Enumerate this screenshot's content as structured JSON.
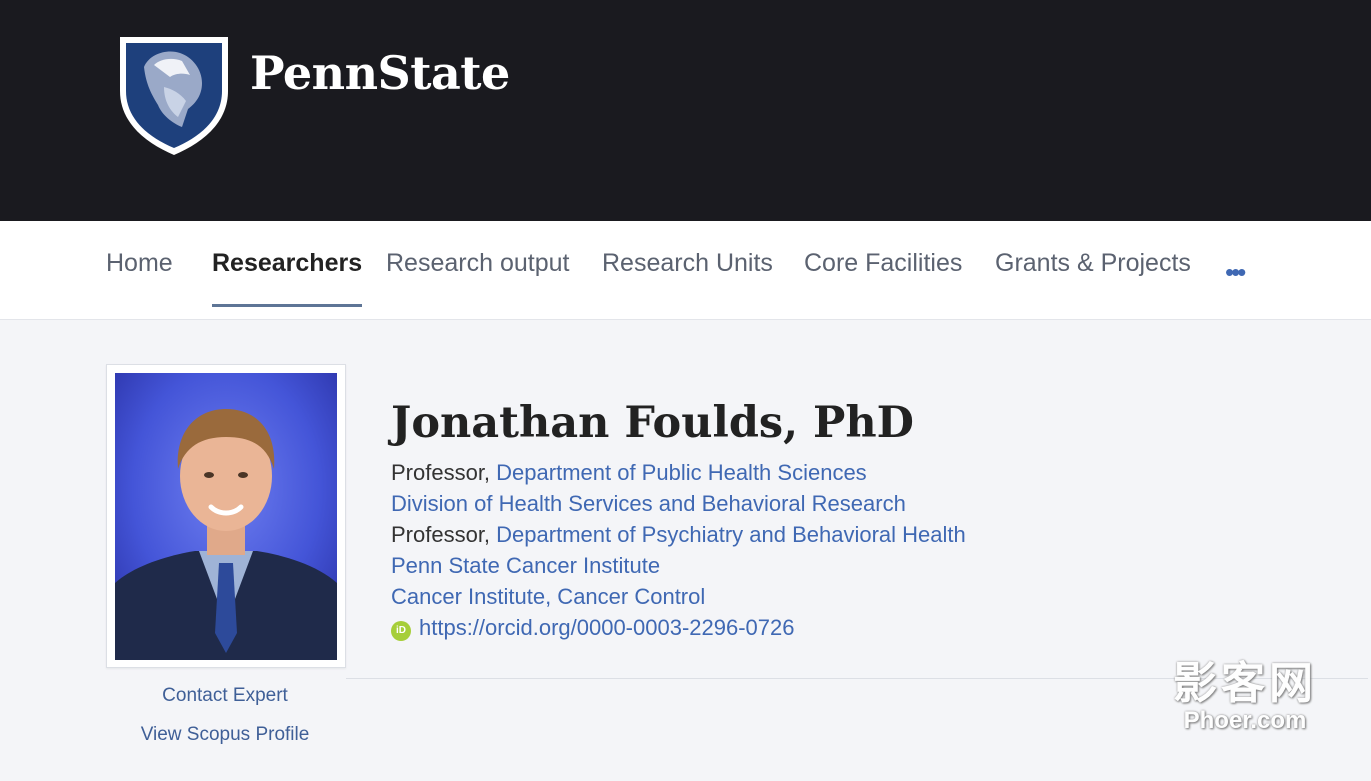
{
  "header": {
    "logo_text": "PennState"
  },
  "nav": {
    "items": [
      {
        "label": "Home"
      },
      {
        "label": "Researchers"
      },
      {
        "label": "Research output"
      },
      {
        "label": "Research Units"
      },
      {
        "label": "Core Facilities"
      },
      {
        "label": "Grants & Projects"
      }
    ],
    "active": "Researchers",
    "more_label": "•••"
  },
  "profile": {
    "name": "Jonathan Foulds, PhD",
    "affiliations": [
      {
        "prefix": "Professor, ",
        "link": "Department of Public Health Sciences"
      },
      {
        "prefix": "",
        "link": "Division of Health Services and Behavioral Research"
      },
      {
        "prefix": "Professor, ",
        "link": "Department of Psychiatry and Behavioral Health"
      },
      {
        "prefix": "",
        "link": "Penn State Cancer Institute"
      },
      {
        "prefix": "",
        "link": "Cancer Institute, Cancer Control"
      }
    ],
    "orcid_icon_label": "iD",
    "orcid": "https://orcid.org/0000-0003-2296-0726"
  },
  "sidebar": {
    "contact_label": "Contact Expert",
    "scopus_label": "View Scopus Profile"
  },
  "watermark": {
    "cn": "影客网",
    "en": "Phoer.com"
  },
  "colors": {
    "header_bg": "#1a1a1f",
    "link": "#3f68b3",
    "nav_active_underline": "#5e7596",
    "page_bg": "#f4f5f8",
    "orcid": "#a6ce39"
  }
}
